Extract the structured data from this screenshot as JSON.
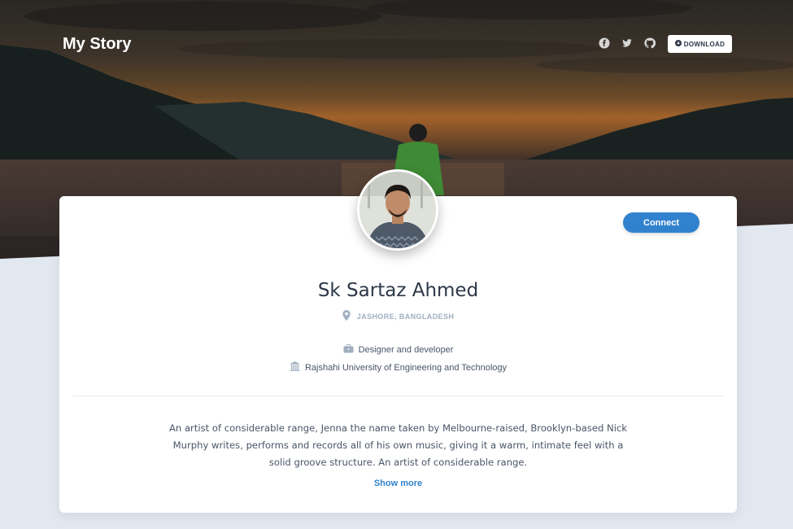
{
  "navbar": {
    "brand": "My Story",
    "social": [
      {
        "icon": "facebook-icon"
      },
      {
        "icon": "twitter-icon"
      },
      {
        "icon": "github-icon"
      }
    ],
    "download_label": "DOWNLOAD",
    "download_icon": "arrow-down-circle-icon"
  },
  "profile": {
    "connect_label": "Connect",
    "name": "Sk Sartaz Ahmed",
    "location": "JASHORE, BANGLADESH",
    "location_icon": "map-marker-icon",
    "role": "Designer and developer",
    "role_icon": "briefcase-icon",
    "institution": "Rajshahi University of Engineering and Technology",
    "institution_icon": "university-icon",
    "bio": "An artist of considerable range, Jenna the name taken by Melbourne-raised, Brooklyn-based Nick Murphy writes, performs and records all of his own music, giving it a warm, intimate feel with a solid groove structure. An artist of considerable range.",
    "show_more_label": "Show more"
  },
  "colors": {
    "accent": "#3182ce",
    "background": "#e2e8f0",
    "text_dark": "#2d3748",
    "text_muted": "#a0aec0"
  }
}
